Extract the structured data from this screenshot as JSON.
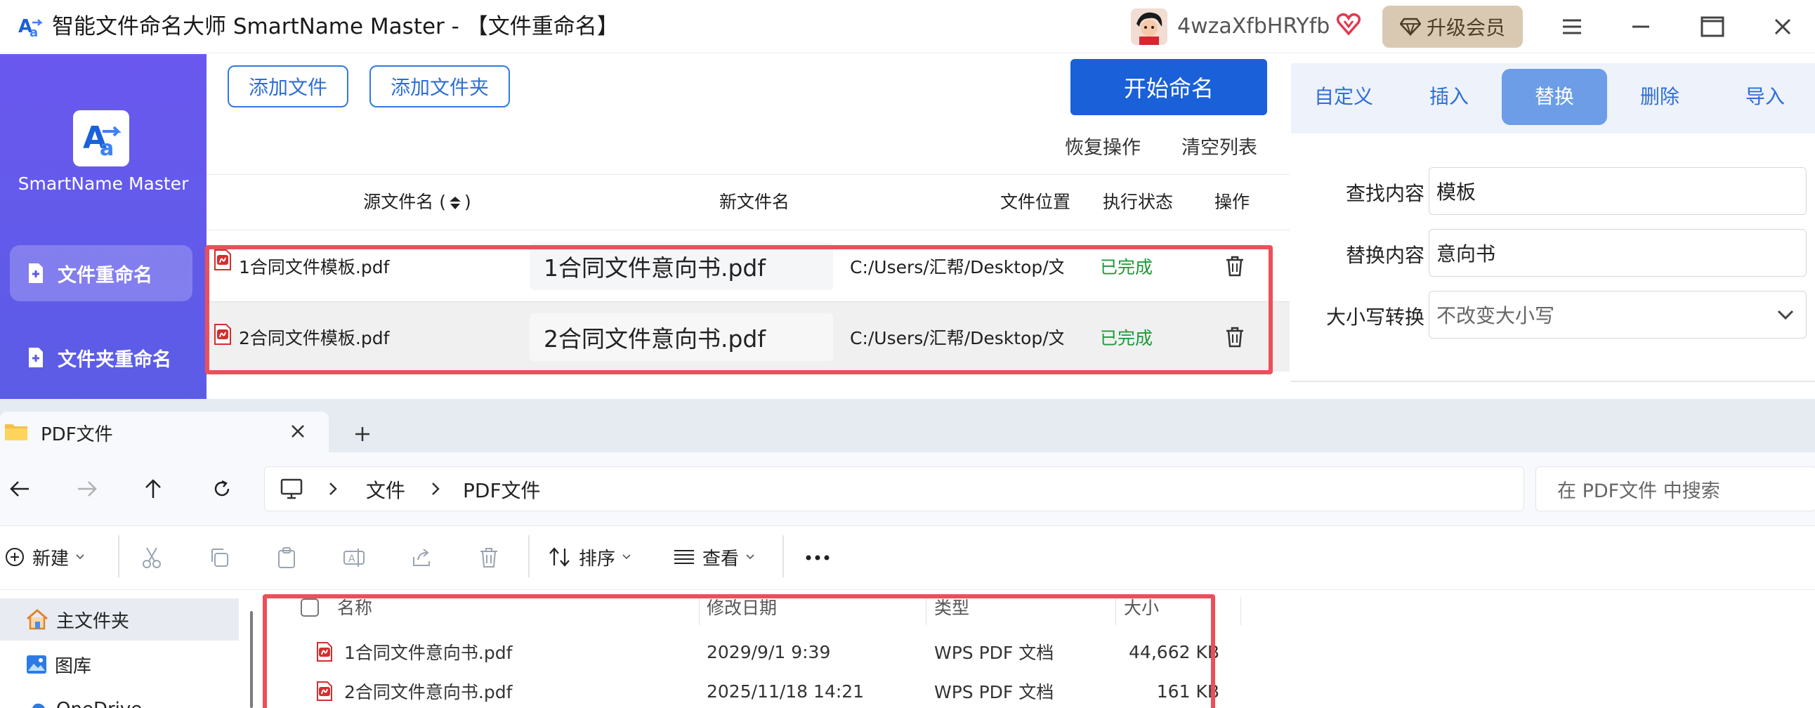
{
  "app": {
    "title": "智能文件命名大师 SmartName Master - 【文件重命名】",
    "brand_name": "SmartName Master",
    "username": "4wzaXfbHRYfb",
    "upgrade_label": "升级会员",
    "accent_color": "#5b5ce6",
    "sidebar": {
      "items": [
        {
          "label": "文件重命名",
          "active": true
        },
        {
          "label": "文件夹重命名",
          "active": false
        }
      ]
    },
    "toolbar": {
      "add_file": "添加文件",
      "add_folder": "添加文件夹",
      "start": "开始命名",
      "undo": "恢复操作",
      "clear": "清空列表"
    },
    "table": {
      "headers": {
        "source": "源文件名 (",
        "source_suffix": ")",
        "new_name": "新文件名",
        "location": "文件位置",
        "status": "执行状态",
        "action": "操作"
      },
      "rows": [
        {
          "source": "1合同文件模板.pdf",
          "new_name": "1合同文件意向书.pdf",
          "location": "C:/Users/汇帮/Desktop/文件",
          "status": "已完成"
        },
        {
          "source": "2合同文件模板.pdf",
          "new_name": "2合同文件意向书.pdf",
          "location": "C:/Users/汇帮/Desktop/文件",
          "status": "已完成"
        }
      ]
    },
    "tabs": [
      {
        "label": "自定义",
        "active": false
      },
      {
        "label": "插入",
        "active": false
      },
      {
        "label": "替换",
        "active": true
      },
      {
        "label": "删除",
        "active": false
      },
      {
        "label": "导入",
        "active": false
      }
    ],
    "form": {
      "find_label": "查找内容",
      "find_value": "模板",
      "replace_label": "替换内容",
      "replace_value": "意向书",
      "case_label": "大小写转换",
      "case_value": "不改变大小写"
    }
  },
  "explorer": {
    "tab_title": "PDF文件",
    "breadcrumb": [
      "文件",
      "PDF文件"
    ],
    "search_placeholder": "在 PDF文件 中搜索",
    "commands": {
      "new": "新建",
      "sort": "排序",
      "view": "查看"
    },
    "nav_pane": {
      "home": "主文件夹",
      "gallery": "图库",
      "onedrive": "OneDrive"
    },
    "columns": {
      "name": "名称",
      "modified": "修改日期",
      "type": "类型",
      "size": "大小"
    },
    "files": [
      {
        "name": "1合同文件意向书.pdf",
        "modified": "2029/9/1 9:39",
        "type": "WPS PDF 文档",
        "size": "44,662 KB"
      },
      {
        "name": "2合同文件意向书.pdf",
        "modified": "2025/11/18 14:21",
        "type": "WPS PDF 文档",
        "size": "161 KB"
      }
    ],
    "highlight_color": "#ec4f5a"
  }
}
